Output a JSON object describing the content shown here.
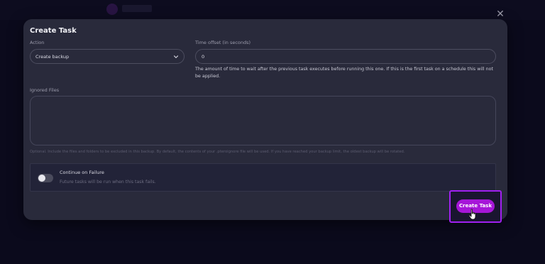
{
  "modal": {
    "title": "Create Task",
    "close_icon": "close-icon"
  },
  "action": {
    "label": "Action",
    "selected": "Create backup",
    "icon": "chevron-down-icon"
  },
  "time_offset": {
    "label": "Time offset (in seconds)",
    "value": "0",
    "help": "The amount of time to wait after the previous task executes before running this one. If this is the first task on a schedule this will not be applied."
  },
  "ignored_files": {
    "label": "Ignored Files",
    "value": "",
    "help": "Optional. Include the files and folders to be excluded in this backup. By default, the contents of your .pteroignore file will be used. If you have reached your backup limit, the oldest backup will be rotated."
  },
  "continue_on_failure": {
    "label": "Continue on Failure",
    "description": "Future tasks will be run when this task fails.",
    "enabled": false
  },
  "submit": {
    "label": "Create Task"
  },
  "colors": {
    "accent": "#a616d8",
    "highlight": "#a020f0",
    "panel": "#292a3b",
    "background": "#0b0a1c"
  }
}
